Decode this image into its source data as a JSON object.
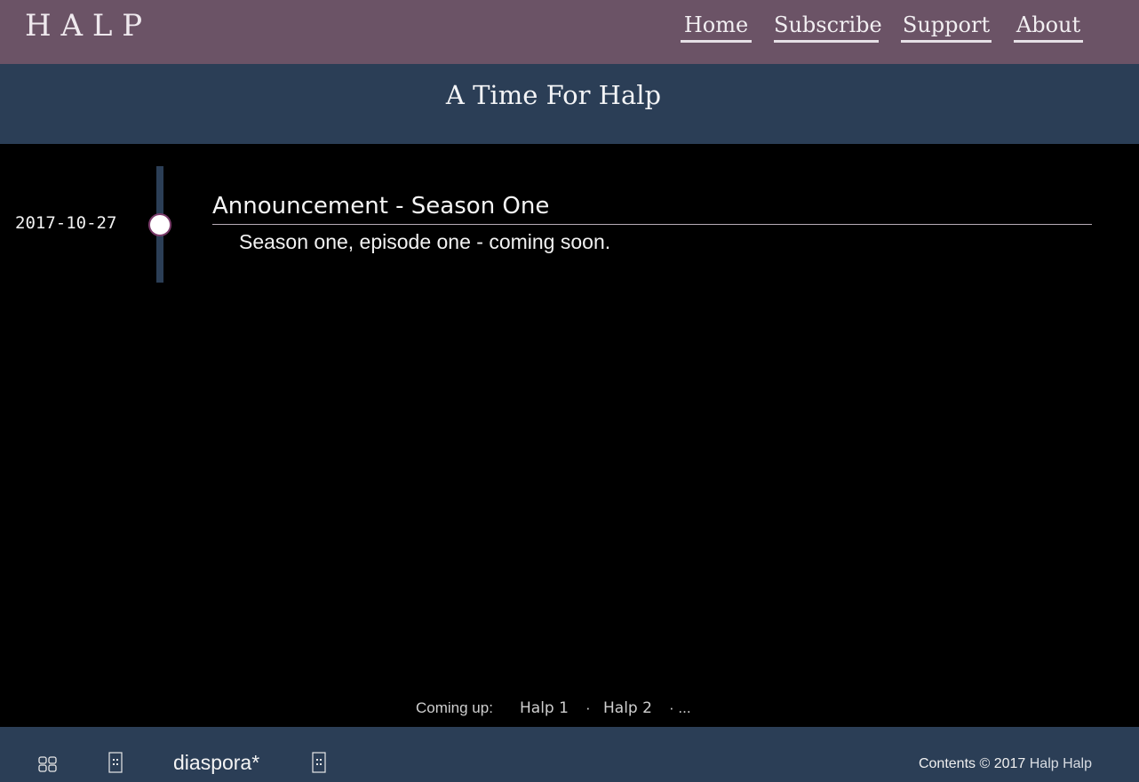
{
  "site": {
    "logo": "H A L P"
  },
  "nav": {
    "items": [
      "Home",
      "Subscribe",
      "Support",
      "About"
    ]
  },
  "banner": {
    "title": "A Time For Halp"
  },
  "timeline": {
    "date": "2017-10-27",
    "post_title": "Announcement - Season One",
    "post_body": "Season one, episode one - coming soon."
  },
  "coming_up": {
    "label": "Coming up:",
    "items": [
      "Halp 1",
      "Halp 2"
    ],
    "separator": "·",
    "more": "· ..."
  },
  "footer": {
    "icons": [
      "grid-icon",
      "small-box-icon",
      "small-box-icon"
    ],
    "diaspora": "diaspora*",
    "copyright_prefix": "Contents © 2017",
    "copyright_owner": "Halp Halp"
  },
  "colors": {
    "header": "#6b5366",
    "banner": "#2b3e56",
    "background": "#000000",
    "timeline_dot_border": "#7a3b6a"
  }
}
